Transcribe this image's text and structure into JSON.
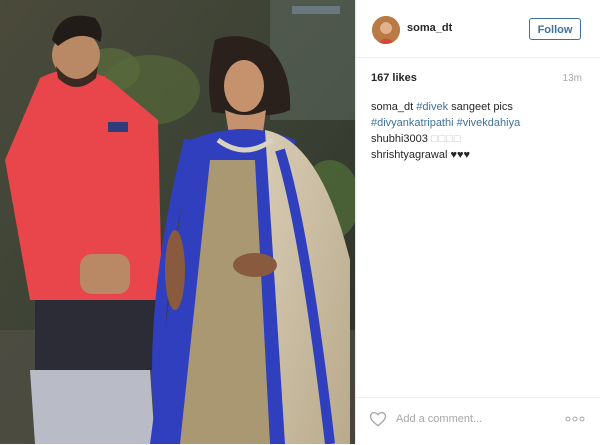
{
  "post": {
    "username": "soma_dt",
    "follow_label": "Follow",
    "likes": "167 likes",
    "time": "13m",
    "comments": [
      {
        "user": "soma_dt",
        "parts": [
          {
            "text": "#divek",
            "tag": true
          },
          {
            "text": " sangeet pics",
            "tag": false
          }
        ],
        "line2": [
          {
            "text": "#divyankatripathi",
            "tag": true
          },
          {
            "text": " ",
            "tag": false
          },
          {
            "text": "#vivekdahiya",
            "tag": true
          }
        ]
      },
      {
        "user": "shubhi3003",
        "extra": "□□□□"
      },
      {
        "user": "shrishtyagrawal",
        "extra": "♥♥♥"
      }
    ],
    "add_comment_placeholder": "Add a comment...",
    "icons": {
      "like": "heart-outline-icon",
      "more": "more-options-icon"
    }
  },
  "colors": {
    "link": "#3f729b",
    "muted": "#a5a7aa",
    "text": "#262626"
  }
}
